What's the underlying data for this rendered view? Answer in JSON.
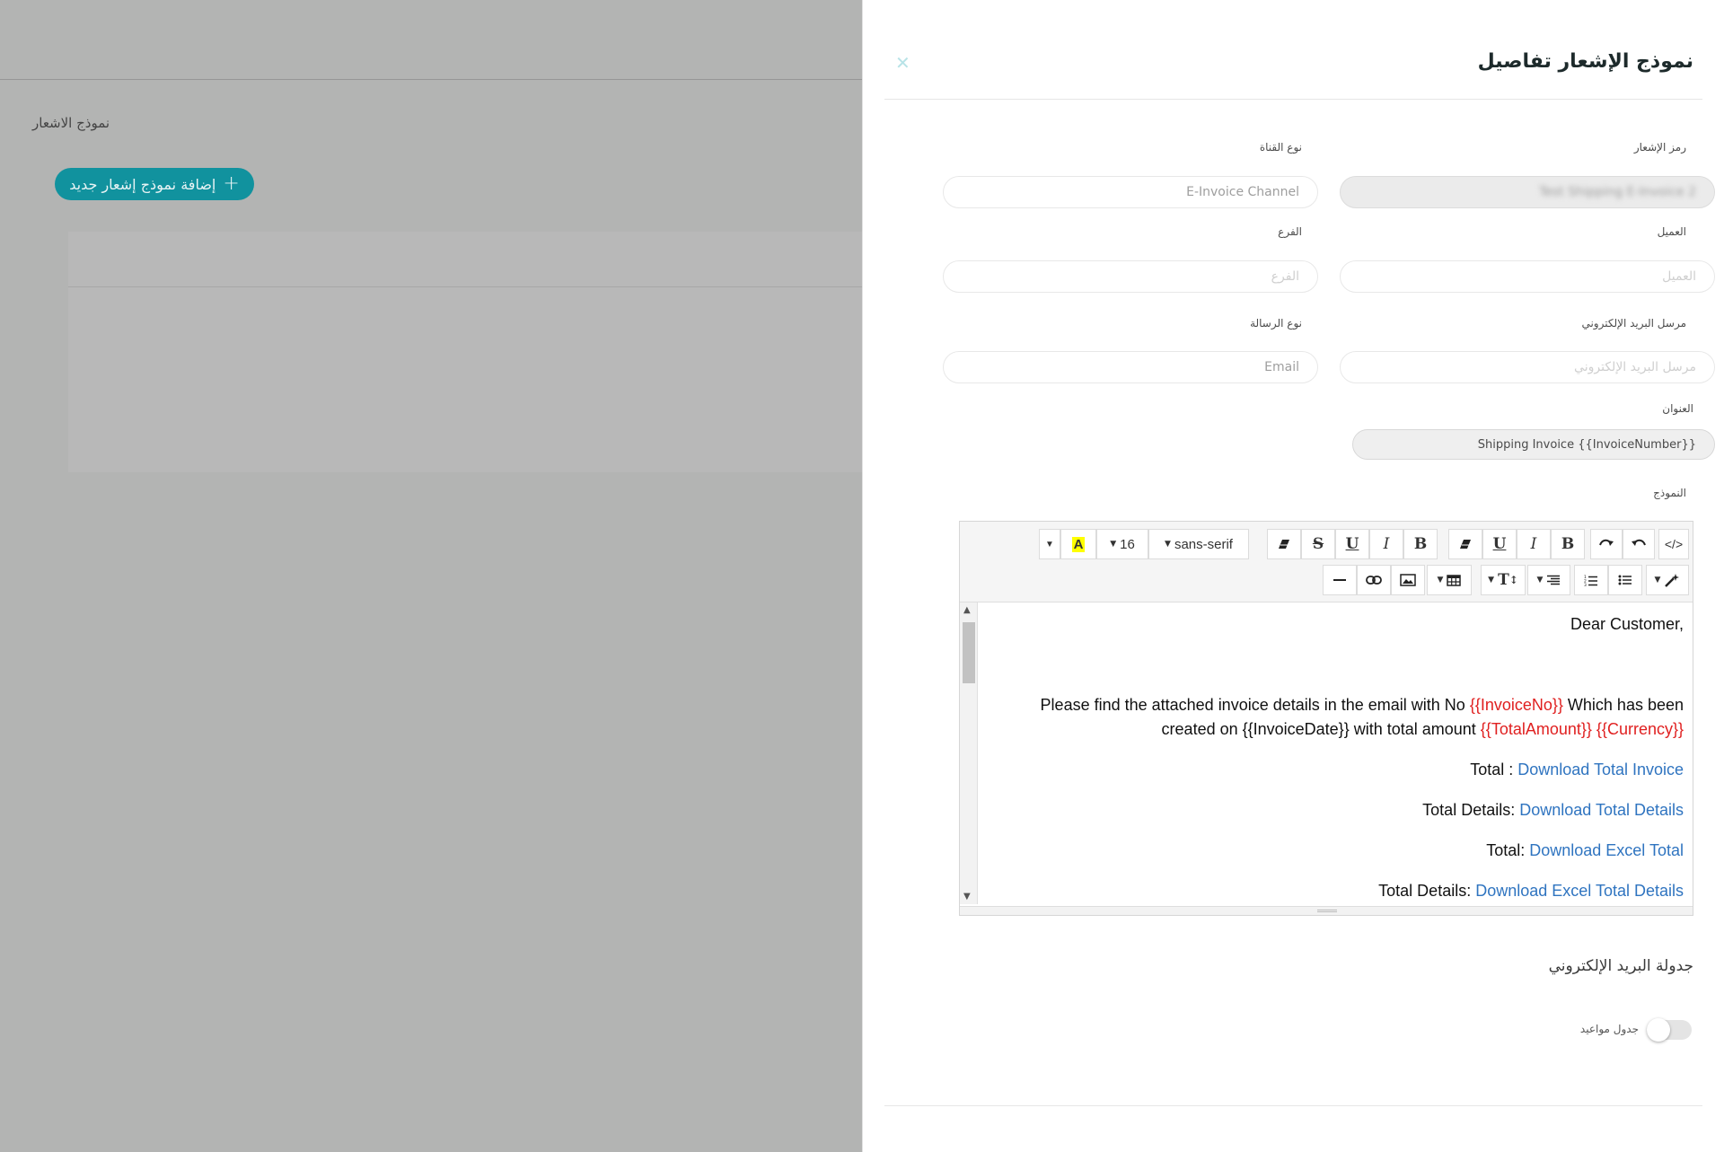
{
  "background": {
    "page_title": "نموذج الاشعار",
    "add_button_label": "إضافة نموذج إشعار جديد",
    "add_button_icon": "plus-icon",
    "accent_color": "#11929e"
  },
  "drawer": {
    "title": "نموذج الإشعار تفاصيل",
    "close_icon": "close-icon"
  },
  "form": {
    "notification_code": {
      "label": "رمز الإشعار",
      "value": "Test Shipping E-Invoice 2"
    },
    "channel_type": {
      "label": "نوع القناة",
      "value": "E-Invoice Channel"
    },
    "client": {
      "label": "العميل",
      "placeholder": "العميل"
    },
    "branch": {
      "label": "الفرع",
      "placeholder": "الفرع"
    },
    "email_sender": {
      "label": "مرسل البريد الإلكتروني",
      "placeholder": "مرسل البريد الإلكتروني"
    },
    "message_type": {
      "label": "نوع الرسالة",
      "value": "Email"
    },
    "subject": {
      "label": "العنوان",
      "value": "Shipping Invoice {{InvoiceNumber}}"
    },
    "template": {
      "label": "النموذج"
    }
  },
  "editor": {
    "toolbar": {
      "code_view": "</>",
      "undo_icon": "undo-icon",
      "redo_icon": "redo-icon",
      "bold": "B",
      "italic": "I",
      "underline": "U",
      "eraser_icon": "eraser-icon",
      "strikethrough": "S",
      "font_family": "sans-serif",
      "font_size": "16",
      "highlight": "A",
      "magic_icon": "magic-wand-icon",
      "ul_icon": "unordered-list-icon",
      "ol_icon": "ordered-list-icon",
      "align_icon": "align-icon",
      "text_height": "T",
      "table_icon": "table-icon",
      "picture_icon": "picture-icon",
      "link_icon": "link-icon",
      "hr_icon": "horizontal-rule-icon"
    },
    "content": {
      "greeting": "Dear Customer,",
      "line1_prefix": "Please find the attached invoice details in the email with No ",
      "line1_var": "{{InvoiceNo}}",
      "line1_suffix": " Which has been",
      "line2_prefix": "created on {{InvoiceDate}} with total amount ",
      "line2_var1": "{{TotalAmount}}",
      "line2_var2": "{{Currency}}",
      "total_label": "Total : ",
      "total_link": "Download Total Invoice",
      "details_label": "Total Details: ",
      "details_link": "Download Total Details",
      "excel_total_label": "Total: ",
      "excel_total_link": "Download Excel Total",
      "excel_details_label": "Total Details: ",
      "excel_details_link": "Download Excel Total Details"
    }
  },
  "schedule": {
    "section_title": "جدولة البريد الإلكتروني",
    "toggle_label": "جدول مواعيد",
    "toggle_on": false
  }
}
